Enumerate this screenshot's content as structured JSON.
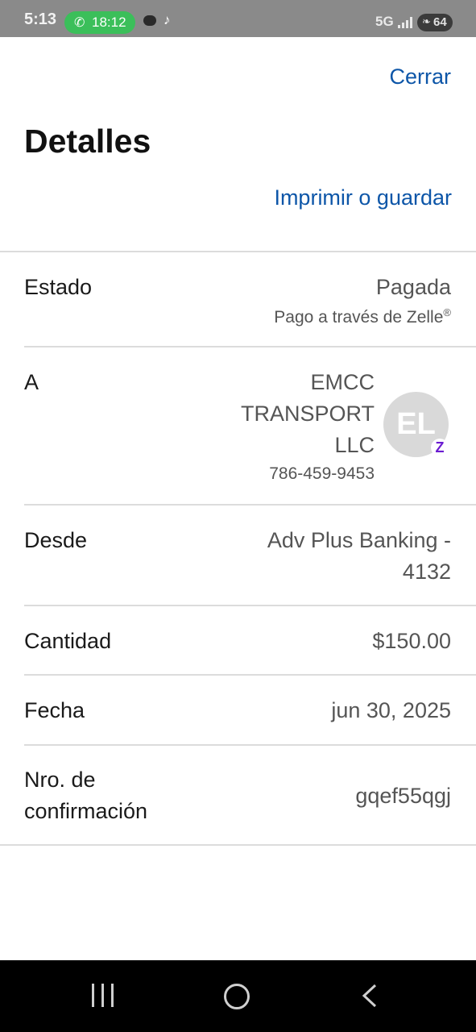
{
  "status_bar": {
    "time": "5:13",
    "call_timer": "18:12",
    "network": "5G",
    "battery": "64"
  },
  "header": {
    "close_label": "Cerrar",
    "title": "Detalles",
    "print_label": "Imprimir o guardar"
  },
  "details": {
    "status": {
      "label": "Estado",
      "value": "Pagada",
      "sub_text": "Pago a través de Zelle",
      "sub_mark": "®"
    },
    "recipient": {
      "label": "A",
      "name": "EMCC TRANSPORT LLC",
      "phone": "786-459-9453",
      "avatar_initials": "EL",
      "badge": "Z"
    },
    "from": {
      "label": "Desde",
      "value": "Adv Plus Banking - 4132"
    },
    "amount": {
      "label": "Cantidad",
      "value": "$150.00"
    },
    "date": {
      "label": "Fecha",
      "value": "jun 30, 2025"
    },
    "confirmation": {
      "label": "Nro. de confirmación",
      "value": "gqef55qgj"
    }
  },
  "colors": {
    "link": "#0d56a8",
    "zelle_purple": "#6b1cd1",
    "call_green": "#3bbf5a"
  },
  "icons": {
    "call": "phone-icon",
    "nav_recent": "recent-apps-icon",
    "nav_home": "home-icon",
    "nav_back": "back-icon"
  }
}
